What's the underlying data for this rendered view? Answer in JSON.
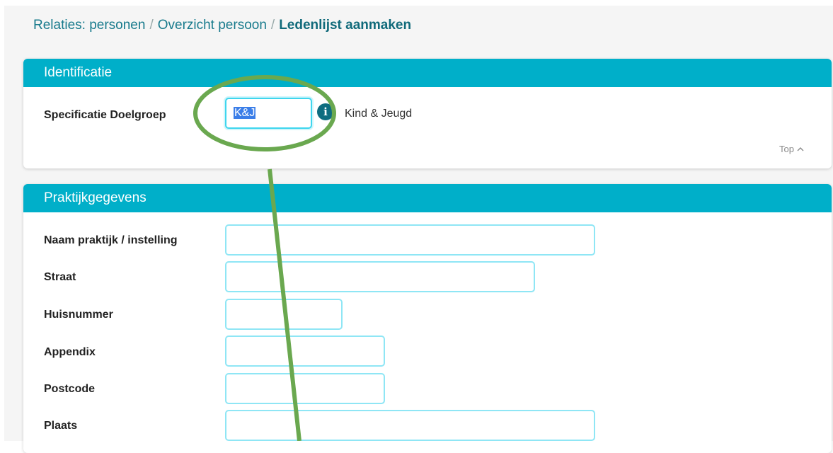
{
  "breadcrumb": {
    "items": [
      "Relaties: personen",
      "Overzicht persoon"
    ],
    "current": "Ledenlijst aanmaken",
    "separator": "/"
  },
  "identificatie": {
    "title": "Identificatie",
    "doelgroep": {
      "label": "Specificatie Doelgroep",
      "value": "K&J",
      "description": "Kind & Jeugd"
    },
    "top_link": "Top"
  },
  "praktijk": {
    "title": "Praktijkgegevens",
    "fields": {
      "naam": {
        "label": "Naam praktijk / instelling",
        "value": ""
      },
      "straat": {
        "label": "Straat",
        "value": ""
      },
      "huisnummer": {
        "label": "Huisnummer",
        "value": ""
      },
      "appendix": {
        "label": "Appendix",
        "value": ""
      },
      "postcode": {
        "label": "Postcode",
        "value": ""
      },
      "plaats": {
        "label": "Plaats",
        "value": ""
      }
    }
  },
  "colors": {
    "header": "#00afc9",
    "input_border": "#8fe6f5",
    "annotation": "#6aa84f",
    "breadcrumb": "#177a8c"
  },
  "icons": {
    "info": "info-icon",
    "chevron": "chevron-up-icon"
  }
}
